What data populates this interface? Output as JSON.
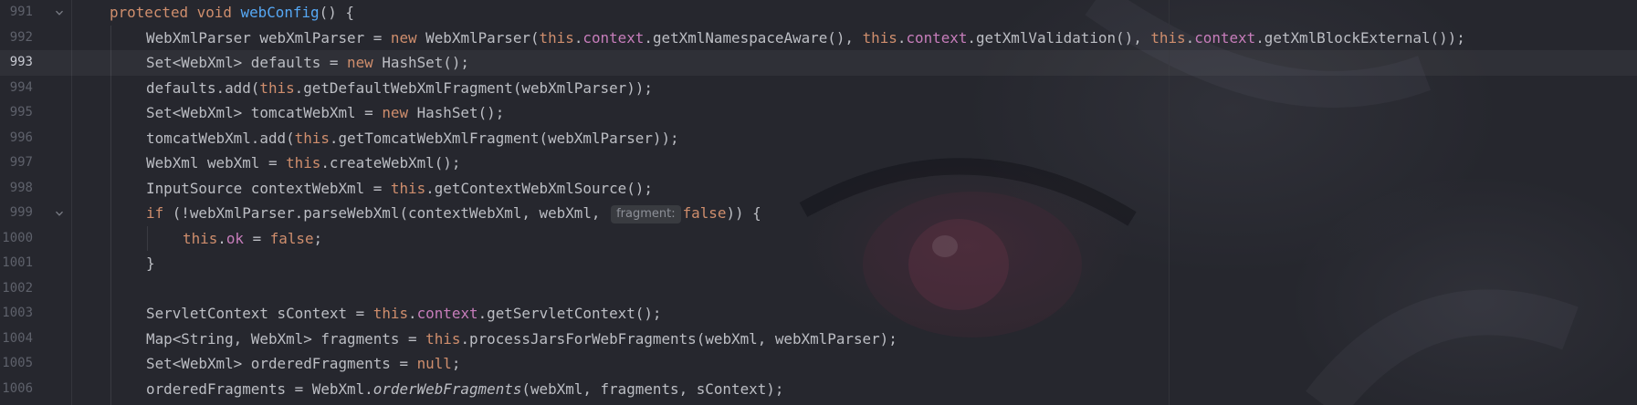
{
  "editor": {
    "current_line": "993",
    "lines": [
      {
        "num": "991",
        "fold": true,
        "indent": 0,
        "tokens": [
          {
            "t": "protected void ",
            "c": "kw"
          },
          {
            "t": "webConfig",
            "c": "fn"
          },
          {
            "t": "() {",
            "c": ""
          }
        ]
      },
      {
        "num": "992",
        "indent": 1,
        "tokens": [
          {
            "t": "WebXmlParser webXmlParser = ",
            "c": ""
          },
          {
            "t": "new ",
            "c": "kw"
          },
          {
            "t": "WebXmlParser(",
            "c": ""
          },
          {
            "t": "this",
            "c": "kw"
          },
          {
            "t": ".",
            "c": ""
          },
          {
            "t": "context",
            "c": "fld"
          },
          {
            "t": ".getXmlNamespaceAware(), ",
            "c": ""
          },
          {
            "t": "this",
            "c": "kw"
          },
          {
            "t": ".",
            "c": ""
          },
          {
            "t": "context",
            "c": "fld"
          },
          {
            "t": ".getXmlValidation(), ",
            "c": ""
          },
          {
            "t": "this",
            "c": "kw"
          },
          {
            "t": ".",
            "c": ""
          },
          {
            "t": "context",
            "c": "fld"
          },
          {
            "t": ".getXmlBlockExternal());",
            "c": ""
          }
        ]
      },
      {
        "num": "993",
        "indent": 1,
        "tokens": [
          {
            "t": "Set<WebXml> defaults = ",
            "c": ""
          },
          {
            "t": "new ",
            "c": "kw"
          },
          {
            "t": "HashSet();",
            "c": ""
          }
        ]
      },
      {
        "num": "994",
        "indent": 1,
        "tokens": [
          {
            "t": "defaults.add(",
            "c": ""
          },
          {
            "t": "this",
            "c": "kw"
          },
          {
            "t": ".getDefaultWebXmlFragment(webXmlParser));",
            "c": ""
          }
        ]
      },
      {
        "num": "995",
        "indent": 1,
        "tokens": [
          {
            "t": "Set<WebXml> tomcatWebXml = ",
            "c": ""
          },
          {
            "t": "new ",
            "c": "kw"
          },
          {
            "t": "HashSet();",
            "c": ""
          }
        ]
      },
      {
        "num": "996",
        "indent": 1,
        "tokens": [
          {
            "t": "tomcatWebXml.add(",
            "c": ""
          },
          {
            "t": "this",
            "c": "kw"
          },
          {
            "t": ".getTomcatWebXmlFragment(webXmlParser));",
            "c": ""
          }
        ]
      },
      {
        "num": "997",
        "indent": 1,
        "tokens": [
          {
            "t": "WebXml webXml = ",
            "c": ""
          },
          {
            "t": "this",
            "c": "kw"
          },
          {
            "t": ".createWebXml();",
            "c": ""
          }
        ]
      },
      {
        "num": "998",
        "indent": 1,
        "tokens": [
          {
            "t": "InputSource contextWebXml = ",
            "c": ""
          },
          {
            "t": "this",
            "c": "kw"
          },
          {
            "t": ".getContextWebXmlSource();",
            "c": ""
          }
        ]
      },
      {
        "num": "999",
        "fold": true,
        "indent": 1,
        "tokens": [
          {
            "t": "if ",
            "c": "kw"
          },
          {
            "t": "(!webXmlParser.parseWebXml(contextWebXml, webXml, ",
            "c": ""
          },
          {
            "t": "fragment:",
            "c": "hint"
          },
          {
            "t": "false",
            "c": "kw"
          },
          {
            "t": ")) {",
            "c": ""
          }
        ]
      },
      {
        "num": "1000",
        "indent": 2,
        "tokens": [
          {
            "t": "this",
            "c": "kw"
          },
          {
            "t": ".",
            "c": ""
          },
          {
            "t": "ok",
            "c": "fld"
          },
          {
            "t": " = ",
            "c": ""
          },
          {
            "t": "false",
            "c": "kw"
          },
          {
            "t": ";",
            "c": ""
          }
        ]
      },
      {
        "num": "1001",
        "indent": 1,
        "tokens": [
          {
            "t": "}",
            "c": ""
          }
        ]
      },
      {
        "num": "1002",
        "indent": 1,
        "tokens": []
      },
      {
        "num": "1003",
        "indent": 1,
        "tokens": [
          {
            "t": "ServletContext sContext = ",
            "c": ""
          },
          {
            "t": "this",
            "c": "kw"
          },
          {
            "t": ".",
            "c": ""
          },
          {
            "t": "context",
            "c": "fld"
          },
          {
            "t": ".getServletContext();",
            "c": ""
          }
        ]
      },
      {
        "num": "1004",
        "indent": 1,
        "tokens": [
          {
            "t": "Map<String, WebXml> fragments = ",
            "c": ""
          },
          {
            "t": "this",
            "c": "kw"
          },
          {
            "t": ".processJarsForWebFragments(webXml, webXmlParser);",
            "c": ""
          }
        ]
      },
      {
        "num": "1005",
        "indent": 1,
        "tokens": [
          {
            "t": "Set<WebXml> orderedFragments = ",
            "c": ""
          },
          {
            "t": "null",
            "c": "kw"
          },
          {
            "t": ";",
            "c": ""
          }
        ]
      },
      {
        "num": "1006",
        "indent": 1,
        "tokens": [
          {
            "t": "orderedFragments = WebXml.",
            "c": ""
          },
          {
            "t": "orderWebFragments",
            "c": "it"
          },
          {
            "t": "(webXml, fragments, sContext);",
            "c": ""
          }
        ]
      }
    ]
  },
  "colors": {
    "background": "#26272e",
    "keyword": "#cf8e6d",
    "method_declaration": "#56a8f5",
    "field": "#c77dbb",
    "default_text": "#bcbec4",
    "line_number": "#5e616b",
    "inlay_hint_bg": "#393b40"
  },
  "icons": {
    "fold": "chevron-down-icon"
  }
}
